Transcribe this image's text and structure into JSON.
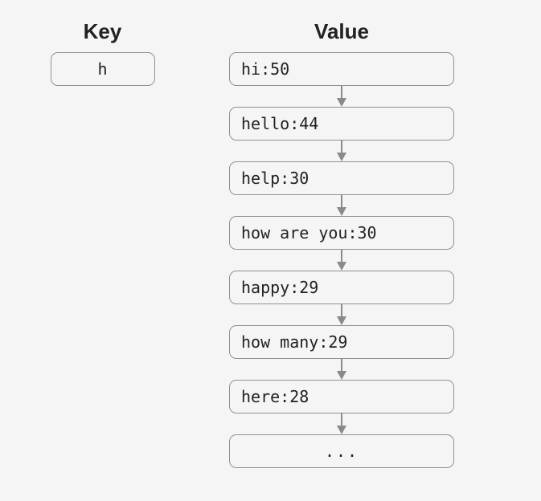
{
  "headers": {
    "key": "Key",
    "value": "Value"
  },
  "key": "h",
  "values": [
    "hi:50",
    "hello:44",
    "help:30",
    "how are you:30",
    "happy:29",
    "how many:29",
    "here:28"
  ],
  "ellipsis": "..."
}
